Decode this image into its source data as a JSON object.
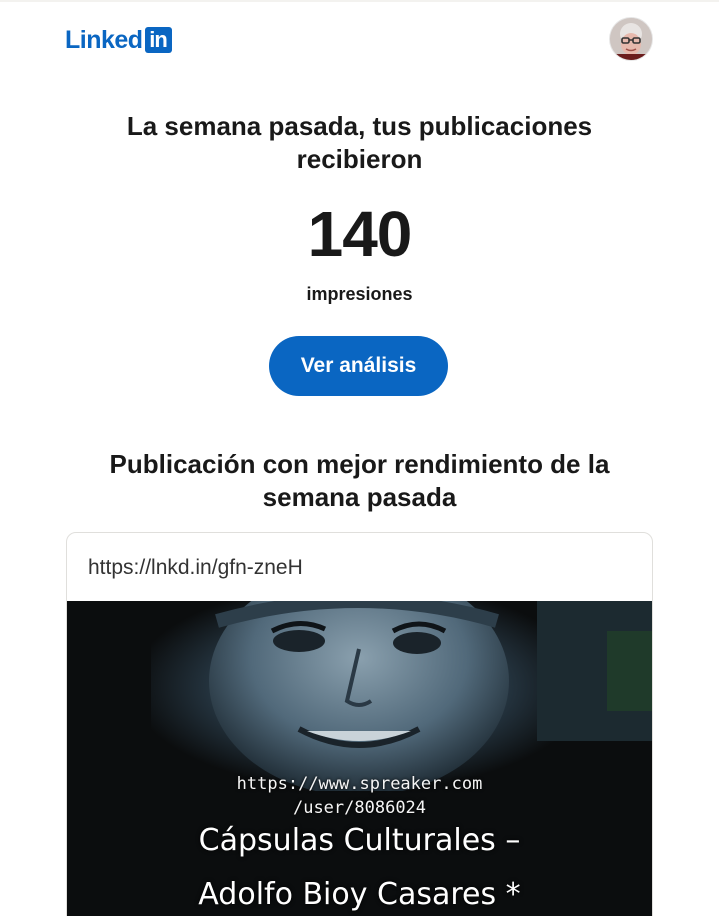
{
  "header": {
    "logo_text": "Linked",
    "logo_box_text": "in"
  },
  "summary": {
    "headline": "La semana pasada, tus publicaciones recibieron",
    "count": "140",
    "unit": "impresiones",
    "cta_label": "Ver análisis"
  },
  "top_post": {
    "heading": "Publicación con mejor rendimiento de la semana pasada",
    "link": "https://lnkd.in/gfn-zneH",
    "image_url_line1": "https://www.spreaker.com",
    "image_url_line2": "/user/8086024",
    "image_title_line1": "Cápsulas Culturales –",
    "image_title_line2": "Adolfo Bioy Casares *"
  },
  "colors": {
    "brand": "#0a66c2",
    "text": "#191919"
  }
}
